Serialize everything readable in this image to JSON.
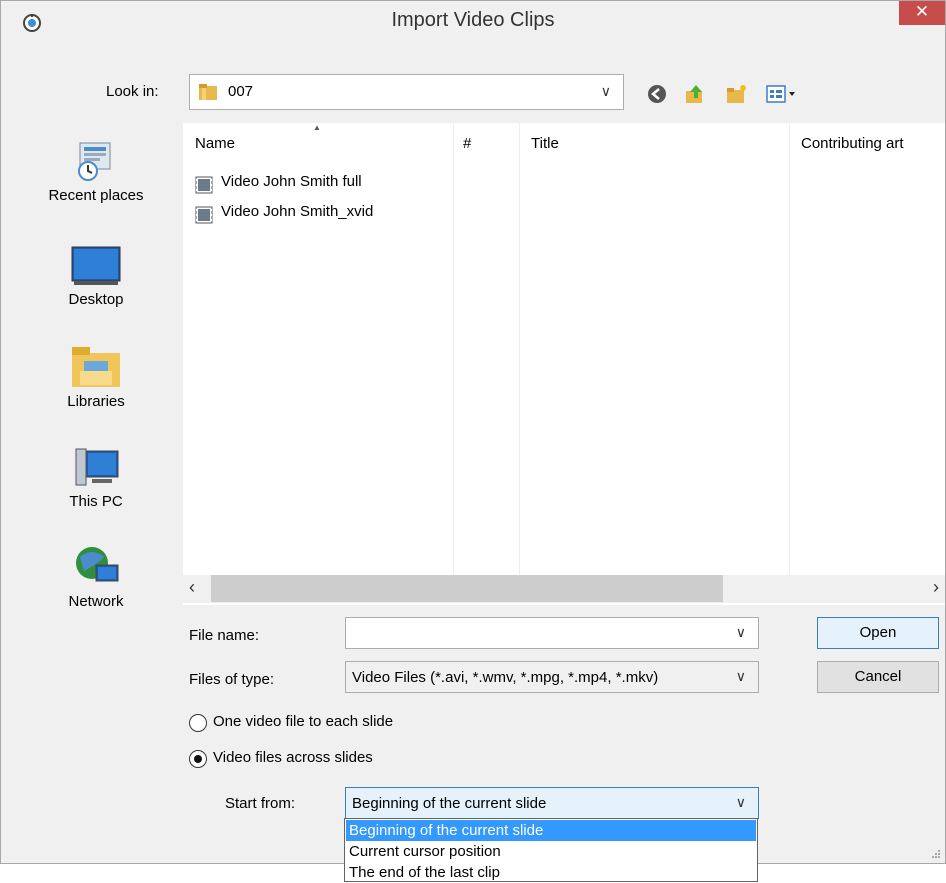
{
  "window": {
    "title": "Import Video Clips",
    "close_glyph": "✕"
  },
  "lookin": {
    "label": "Look in:",
    "value": "007",
    "arrow": "∨"
  },
  "toolbar": {
    "icons": [
      "back-icon",
      "up-folder-icon",
      "new-folder-icon",
      "view-menu-icon"
    ]
  },
  "places": [
    {
      "label": "Recent places",
      "icon": "recent-places-icon"
    },
    {
      "label": "Desktop",
      "icon": "desktop-icon"
    },
    {
      "label": "Libraries",
      "icon": "libraries-icon"
    },
    {
      "label": "This PC",
      "icon": "this-pc-icon"
    },
    {
      "label": "Network",
      "icon": "network-icon"
    }
  ],
  "filelist": {
    "columns": [
      "Name",
      "#",
      "Title",
      "Contributing art"
    ],
    "files": [
      {
        "name": "Video John Smith full",
        "icon": "video-file-icon"
      },
      {
        "name": "Video John Smith_xvid",
        "icon": "video-file-icon"
      }
    ],
    "scroll_left": "‹",
    "scroll_right": "›"
  },
  "form": {
    "filename_label": "File name:",
    "filename_value": "",
    "filetype_label": "Files of type:",
    "filetype_value": "Video Files (*.avi, *.wmv, *.mpg, *.mp4, *.mkv)",
    "open_label": "Open",
    "cancel_label": "Cancel"
  },
  "options": {
    "radio1_label": "One video file to each slide",
    "radio2_label": "Video files across slides",
    "selected": "radio2",
    "start_from_label": "Start from:",
    "start_from_value": "Beginning of the current slide",
    "dropdown_options": [
      "Beginning of the current slide",
      "Current cursor position",
      "The end of the last clip"
    ]
  },
  "colors": {
    "close": "#c74c4c",
    "selection": "#3399ff",
    "window_bg": "#f0f0f0"
  }
}
